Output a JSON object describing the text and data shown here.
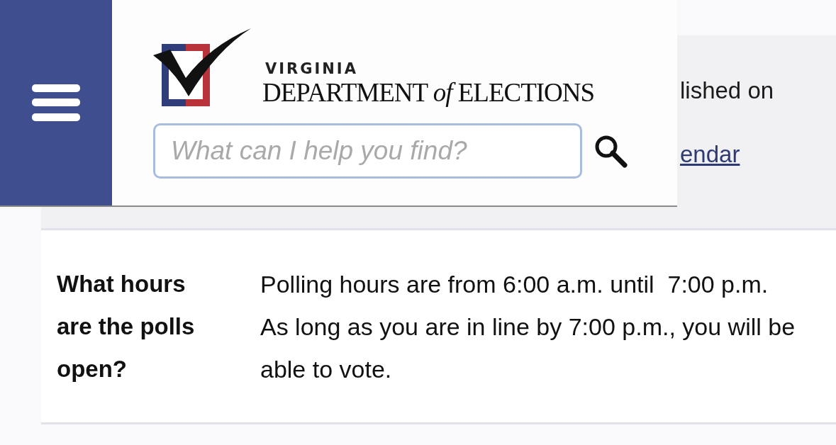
{
  "header": {
    "logo": {
      "state_line": "VIRGINIA",
      "agency_line": "DEPARTMENT *of* ELECTIONS"
    },
    "search": {
      "placeholder": "What can I help you find?"
    }
  },
  "behind_header": {
    "text": "lished on",
    "link": "endar"
  },
  "faq": [
    {
      "question": "What hours are the polls open?",
      "answer": "Polling hours are from 6:00 a.m. until  7:00 p.m.  As long as you are in line by 7:00 p.m., you will be able to vote."
    }
  ]
}
